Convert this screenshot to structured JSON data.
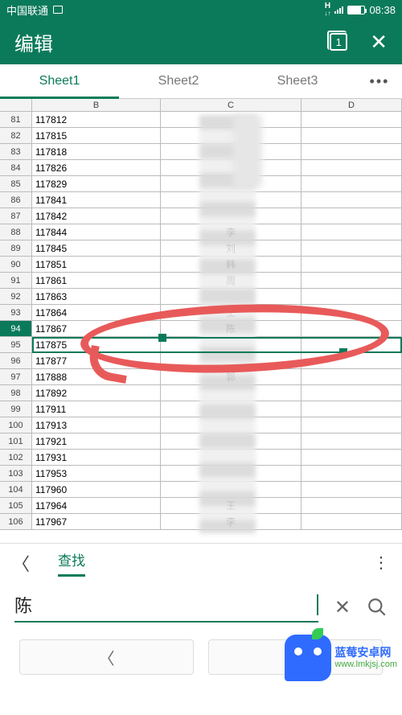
{
  "status": {
    "carrier": "中国联通",
    "network": "H",
    "time": "08:38"
  },
  "header": {
    "title": "编辑",
    "tab_count": "1"
  },
  "tabs": {
    "items": [
      "Sheet1",
      "Sheet2",
      "Sheet3"
    ],
    "active": 0
  },
  "columns": [
    "B",
    "C",
    "D"
  ],
  "rows": [
    {
      "n": "81",
      "b": "117812",
      "c": ""
    },
    {
      "n": "82",
      "b": "117815",
      "c": ""
    },
    {
      "n": "83",
      "b": "117818",
      "c": ""
    },
    {
      "n": "84",
      "b": "117826",
      "c": ""
    },
    {
      "n": "85",
      "b": "117829",
      "c": ""
    },
    {
      "n": "86",
      "b": "117841",
      "c": ""
    },
    {
      "n": "87",
      "b": "117842",
      "c": ""
    },
    {
      "n": "88",
      "b": "117844",
      "c": "李"
    },
    {
      "n": "89",
      "b": "117845",
      "c": "刘"
    },
    {
      "n": "90",
      "b": "117851",
      "c": "韩"
    },
    {
      "n": "91",
      "b": "117861",
      "c": "周"
    },
    {
      "n": "92",
      "b": "117863",
      "c": ""
    },
    {
      "n": "93",
      "b": "117864",
      "c": "王"
    },
    {
      "n": "94",
      "b": "117867",
      "c": "陈"
    },
    {
      "n": "95",
      "b": "117875",
      "c": ""
    },
    {
      "n": "96",
      "b": "117877",
      "c": ""
    },
    {
      "n": "97",
      "b": "117888",
      "c": "郭"
    },
    {
      "n": "98",
      "b": "117892",
      "c": ""
    },
    {
      "n": "99",
      "b": "117911",
      "c": ""
    },
    {
      "n": "100",
      "b": "117913",
      "c": ""
    },
    {
      "n": "101",
      "b": "117921",
      "c": ""
    },
    {
      "n": "102",
      "b": "117931",
      "c": ""
    },
    {
      "n": "103",
      "b": "117953",
      "c": ""
    },
    {
      "n": "104",
      "b": "117960",
      "c": ""
    },
    {
      "n": "105",
      "b": "117964",
      "c": "王"
    },
    {
      "n": "106",
      "b": "117967",
      "c": "李"
    }
  ],
  "selected_row": "94",
  "find": {
    "tab_label": "查找",
    "query": "陈"
  },
  "watermark": {
    "text": "蓝莓安卓网",
    "url": "www.lmkjsj.com"
  }
}
